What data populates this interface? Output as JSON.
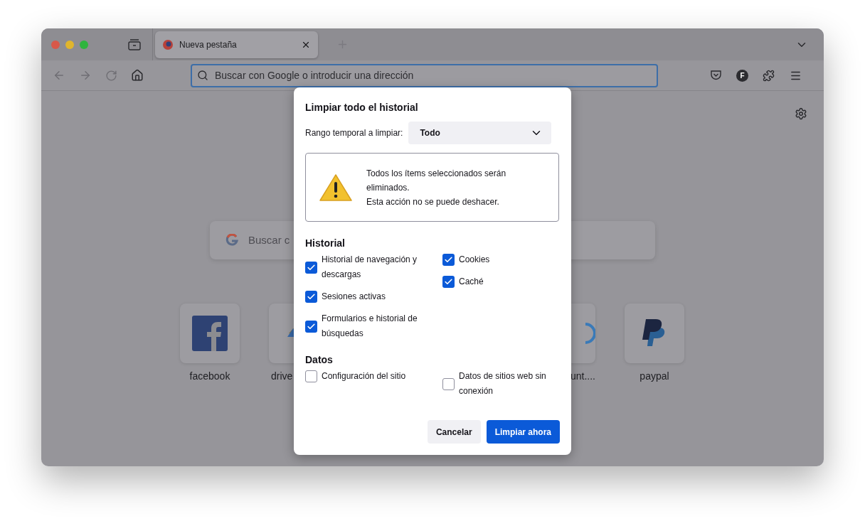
{
  "tab": {
    "title": "Nueva pestaña",
    "selected": true
  },
  "toolbar": {
    "address_placeholder": "Buscar con Google o introducir una dirección",
    "avatar": "F"
  },
  "newtab": {
    "search_placeholder": "Buscar c",
    "tiles": [
      {
        "label": "facebook",
        "kind": "facebook"
      },
      {
        "label": "drive",
        "kind": "drive"
      },
      {
        "label": "unt....",
        "kind": "ring"
      },
      {
        "label": "paypal",
        "kind": "paypal"
      }
    ]
  },
  "dialog": {
    "title": "Limpiar todo el historial",
    "range_label": "Rango temporal a limpiar:",
    "range_value": "Todo",
    "warning": [
      "Todos los ítems seleccionados serán eliminados.",
      "Esta acción no se puede deshacer."
    ],
    "sections": [
      {
        "heading": "Historial",
        "columns": [
          [
            {
              "label": "Historial de navegación y descargas",
              "checked": true
            },
            {
              "label": "Sesiones activas",
              "checked": true
            },
            {
              "label": "Formularios e historial de búsquedas",
              "checked": true
            }
          ],
          [
            {
              "label": "Cookies",
              "checked": true
            },
            {
              "label": "Caché",
              "checked": true
            }
          ]
        ]
      },
      {
        "heading": "Datos",
        "columns": [
          [
            {
              "label": "Configuración del sitio",
              "checked": false
            }
          ],
          [
            {
              "label": "Datos de sitios web sin conexión",
              "checked": false
            }
          ]
        ]
      }
    ],
    "buttons": [
      {
        "label": "Cancelar",
        "kind": "secondary"
      },
      {
        "label": "Limpiar ahora",
        "kind": "primary"
      }
    ]
  }
}
